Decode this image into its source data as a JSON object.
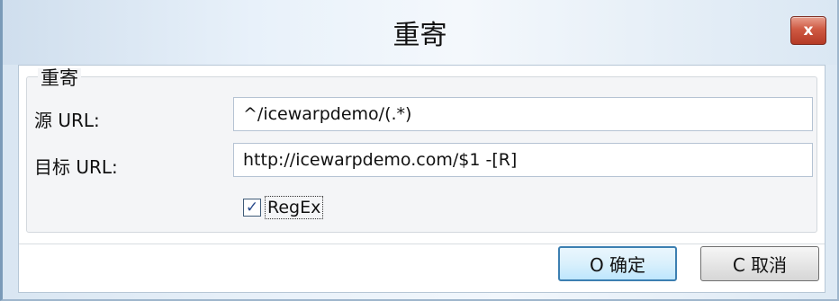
{
  "window": {
    "title": "重寄",
    "close_label": "x"
  },
  "group": {
    "label": "重寄"
  },
  "fields": {
    "source_label": "源 URL:",
    "source_value": "^/icewarpdemo/(.*)",
    "target_label": "目标 URL:",
    "target_value": "http://icewarpdemo.com/$1 -[R]"
  },
  "regex": {
    "label": "RegEx",
    "checked": true,
    "check_glyph": "✓"
  },
  "buttons": {
    "ok_label": "O 确定",
    "cancel_label": "C 取消"
  },
  "colors": {
    "close_button": "#c9492f",
    "default_button_border": "#3c7fb1"
  }
}
